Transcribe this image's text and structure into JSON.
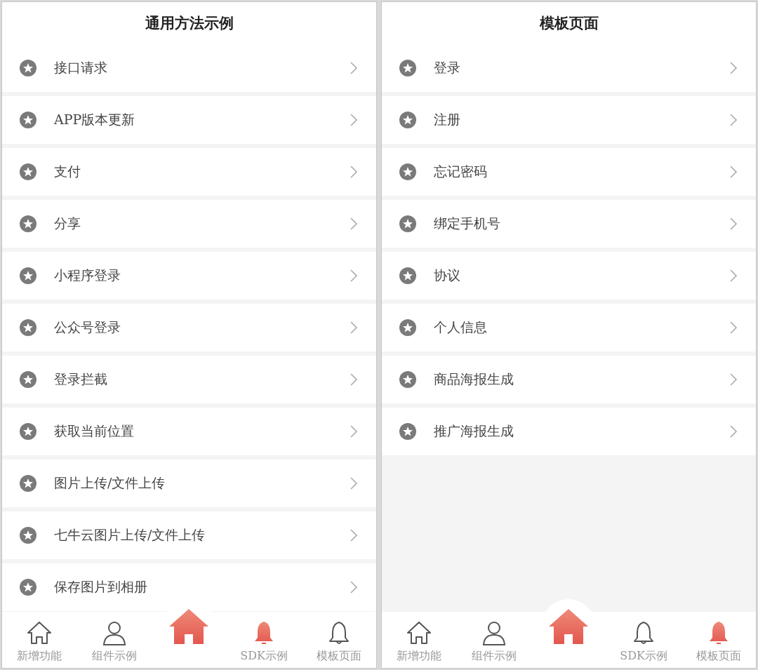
{
  "screens": [
    {
      "title": "通用方法示例",
      "items": [
        "接口请求",
        "APP版本更新",
        "支付",
        "分享",
        "小程序登录",
        "公众号登录",
        "登录拦截",
        "获取当前位置",
        "图片上传/文件上传",
        "七牛云图片上传/文件上传",
        "保存图片到相册"
      ],
      "tabs": [
        {
          "kind": "home",
          "label": "新增功能",
          "selected": false
        },
        {
          "kind": "user",
          "label": "组件示例",
          "selected": false
        },
        {
          "kind": "center",
          "selected": true
        },
        {
          "kind": "bell",
          "label": "SDK示例",
          "selected": true
        },
        {
          "kind": "bell",
          "label": "模板页面",
          "selected": false
        }
      ]
    },
    {
      "title": "模板页面",
      "items": [
        "登录",
        "注册",
        "忘记密码",
        "绑定手机号",
        "协议",
        "个人信息",
        "商品海报生成",
        "推广海报生成"
      ],
      "tabs": [
        {
          "kind": "home",
          "label": "新增功能",
          "selected": false
        },
        {
          "kind": "user",
          "label": "组件示例",
          "selected": false
        },
        {
          "kind": "center",
          "selected": true
        },
        {
          "kind": "bell",
          "label": "SDK示例",
          "selected": false
        },
        {
          "kind": "bell",
          "label": "模板页面",
          "selected": true
        }
      ]
    }
  ]
}
